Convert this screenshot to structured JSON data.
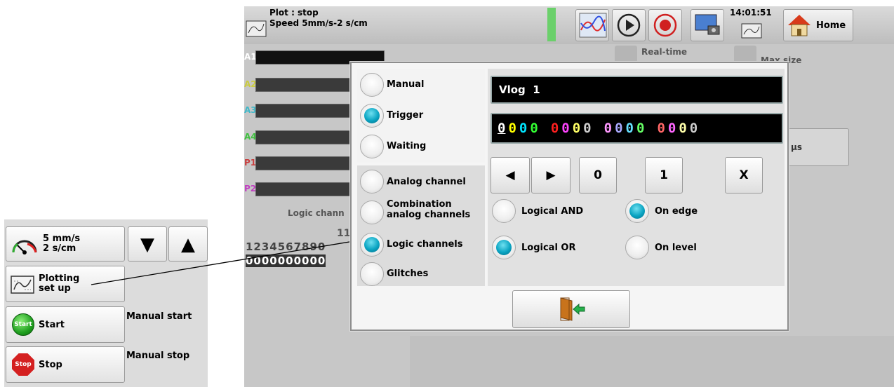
{
  "left_inset": {
    "speed_button": {
      "line1": "5 mm/s",
      "line2": "2 s/cm"
    },
    "down_arrow": "▼",
    "up_arrow": "▲",
    "plotting_button": {
      "line1": "Plotting",
      "line2": "set up"
    },
    "start_button": {
      "icon_text": "Start",
      "label": "Start",
      "description": "Manual start"
    },
    "stop_button": {
      "icon_text": "Stop",
      "label": "Stop",
      "description": "Manual stop"
    }
  },
  "topbar": {
    "status_line1": "Plot : stop",
    "status_line2": "Speed 5mm/s-2 s/cm",
    "time": "14:01:51",
    "home_label": "Home"
  },
  "background": {
    "channels": [
      "A1",
      "A2",
      "A3",
      "A4",
      "P1",
      "P2"
    ],
    "logic_label": "Logic chann",
    "logic_number": "11",
    "logic_digits": "1234567890",
    "logic_values": "0000000000",
    "realtime_label": "Real-time",
    "maxsize_label": "Max size",
    "us_label": "µs"
  },
  "dialog": {
    "mode_options": [
      {
        "label": "Manual",
        "selected": false
      },
      {
        "label": "Trigger",
        "selected": true
      },
      {
        "label": "Waiting",
        "selected": false
      }
    ],
    "channel_options": [
      {
        "label": "Analog channel",
        "selected": false
      },
      {
        "label": "Combination analog channels",
        "selected": false
      },
      {
        "label": "Logic channels",
        "selected": true
      },
      {
        "label": "Glitches",
        "selected": false
      }
    ],
    "name_field": "Vlog  1",
    "bit_groups": [
      {
        "bits": [
          "0",
          "0",
          "0",
          "0"
        ],
        "colors": [
          "#ffffff",
          "#ffff00",
          "#00e5ff",
          "#33ff33"
        ]
      },
      {
        "bits": [
          "0",
          "0",
          "0",
          "0"
        ],
        "colors": [
          "#ff2020",
          "#ff44ff",
          "#ffff66",
          "#cfcfcf"
        ]
      },
      {
        "bits": [
          "0",
          "0",
          "0",
          "0"
        ],
        "colors": [
          "#ff99ff",
          "#aaaaff",
          "#66e0ff",
          "#66ff66"
        ]
      },
      {
        "bits": [
          "0",
          "0",
          "0",
          "0"
        ],
        "colors": [
          "#ff6666",
          "#ff66ff",
          "#ffffaa",
          "#cccccc"
        ]
      }
    ],
    "buttons": {
      "left": "◀",
      "right": "▶",
      "zero": "0",
      "one": "1",
      "x": "X"
    },
    "logic_options": {
      "and": {
        "label": "Logical AND",
        "selected": false
      },
      "or": {
        "label": "Logical OR",
        "selected": true
      },
      "edge": {
        "label": "On edge",
        "selected": true
      },
      "level": {
        "label": "On level",
        "selected": false
      }
    },
    "exit_icon": "exit-door-icon"
  }
}
